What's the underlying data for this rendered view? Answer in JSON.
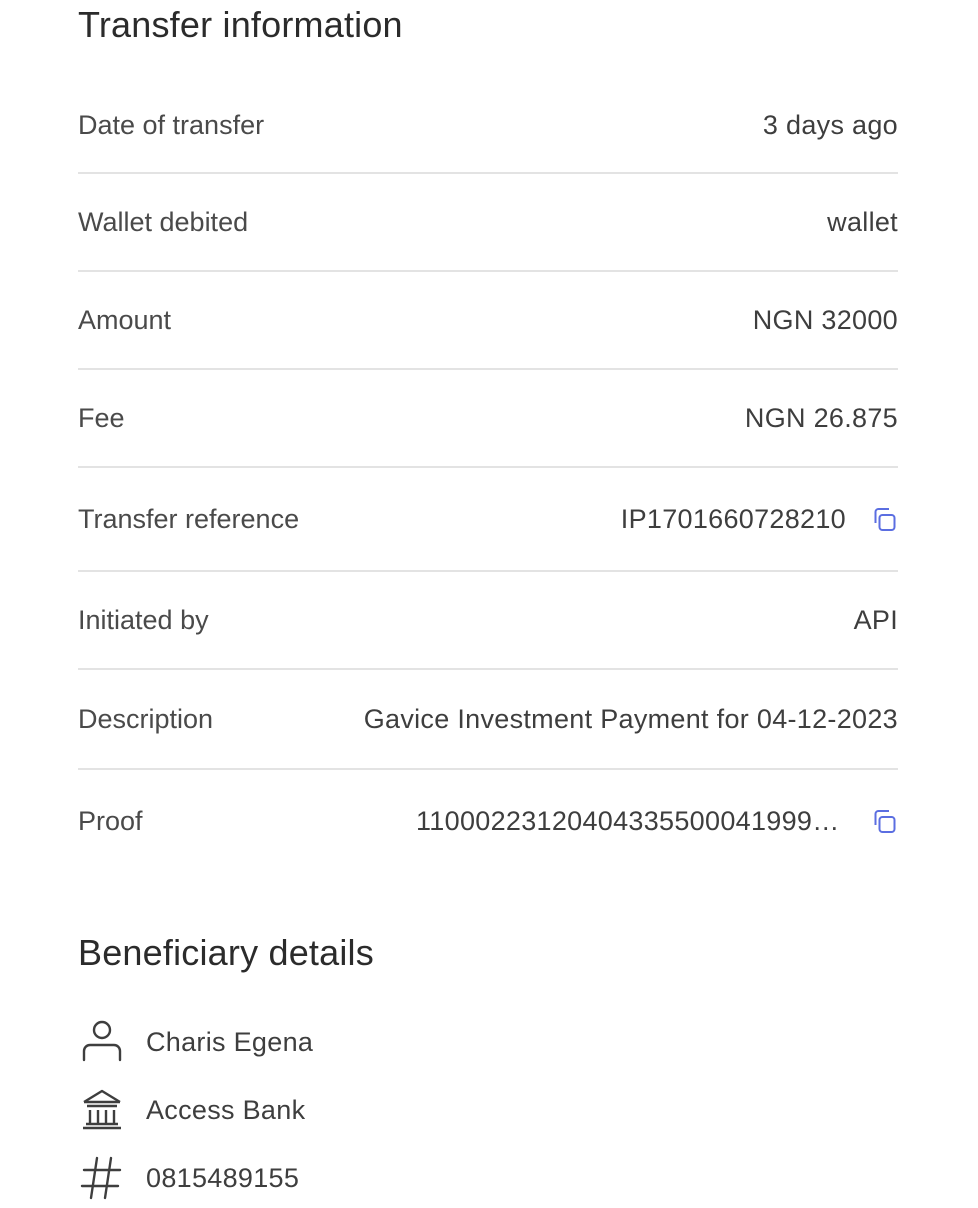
{
  "transfer_info": {
    "title": "Transfer information",
    "rows": [
      {
        "label": "Date of transfer",
        "value": "3 days ago"
      },
      {
        "label": "Wallet debited",
        "value": "wallet"
      },
      {
        "label": "Amount",
        "value": "NGN 32000"
      },
      {
        "label": "Fee",
        "value": "NGN 26.875"
      },
      {
        "label": "Transfer reference",
        "value": "IP1701660728210",
        "icon": "copy-icon"
      },
      {
        "label": "Initiated by",
        "value": "API"
      },
      {
        "label": "Description",
        "value": "Gavice Investment Payment for 04-12-2023"
      },
      {
        "label": "Proof",
        "value": "110002231204043355000419996...",
        "icon": "copy-icon"
      }
    ]
  },
  "beneficiary": {
    "title": "Beneficiary details",
    "name": "Charis Egena",
    "bank": "Access Bank",
    "account_number": "0815489155",
    "icons": [
      "person-icon",
      "bank-icon",
      "hash-icon"
    ]
  },
  "colors": {
    "accent": "#5b6ee1",
    "divider": "#e3e3e3",
    "text": "#3e3e3e",
    "heading": "#2b2b2b"
  }
}
